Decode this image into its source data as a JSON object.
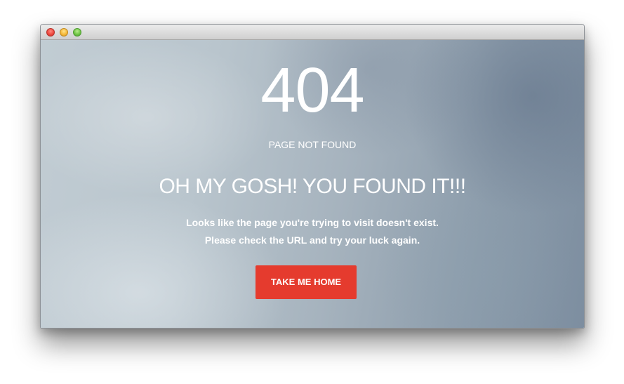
{
  "window": {
    "controls": {
      "close": "close-button",
      "minimize": "minimize-button",
      "zoom": "zoom-button"
    }
  },
  "error": {
    "code": "404",
    "subtitle": "PAGE NOT FOUND",
    "headline": "OH MY GOSH! YOU FOUND IT!!!",
    "message_line1": "Looks like the page you're trying to visit doesn't exist.",
    "message_line2": "Please check the URL and try your luck again.",
    "button_label": "TAKE ME HOME"
  },
  "colors": {
    "button": "#e53b2e",
    "text": "#ffffff",
    "close": "#ef4a40",
    "minimize": "#f6b93a",
    "zoom": "#70c646"
  }
}
